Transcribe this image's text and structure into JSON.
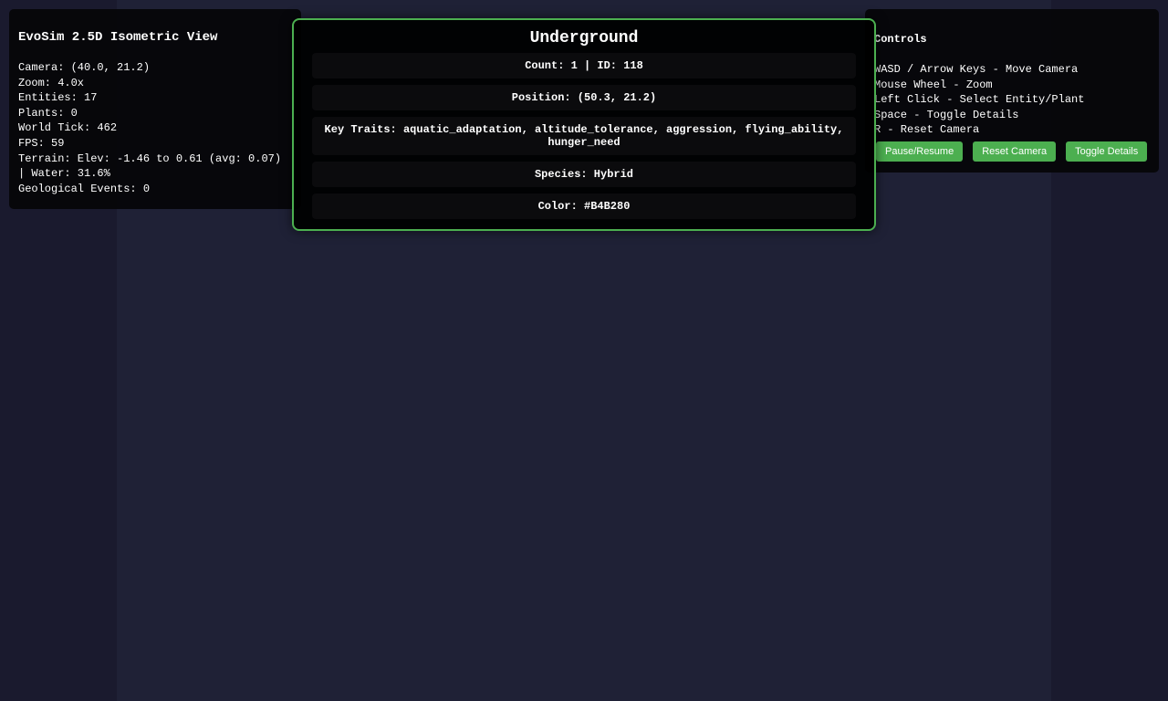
{
  "info": {
    "title": "EvoSim 2.5D Isometric View",
    "lines": [
      "Camera: (40.0, 21.2)",
      "Zoom: 4.0x",
      "Entities: 17",
      "Plants: 0",
      "World Tick: 462",
      "FPS: 59",
      "Terrain: Elev: -1.46 to 0.61 (avg: 0.07) | Water: 31.6%",
      "Geological Events: 0"
    ]
  },
  "entity": {
    "title": "Underground",
    "count_id": "Count: 1 | ID: 118",
    "position": "Position: (50.3, 21.2)",
    "traits": "Key Traits: aquatic_adaptation, altitude_tolerance, aggression, flying_ability, hunger_need",
    "species": "Species: Hybrid",
    "color": "Color: #B4B280",
    "border_color": "#4caf50"
  },
  "controls": {
    "title": "Controls",
    "lines": [
      "WASD / Arrow Keys - Move Camera",
      "Mouse Wheel - Zoom",
      "Left Click - Select Entity/Plant",
      "Space - Toggle Details",
      "R - Reset Camera"
    ],
    "buttons": {
      "pause": "Pause/Resume",
      "reset": "Reset Camera",
      "toggle": "Toggle Details"
    },
    "button_color": "#4caf50"
  }
}
